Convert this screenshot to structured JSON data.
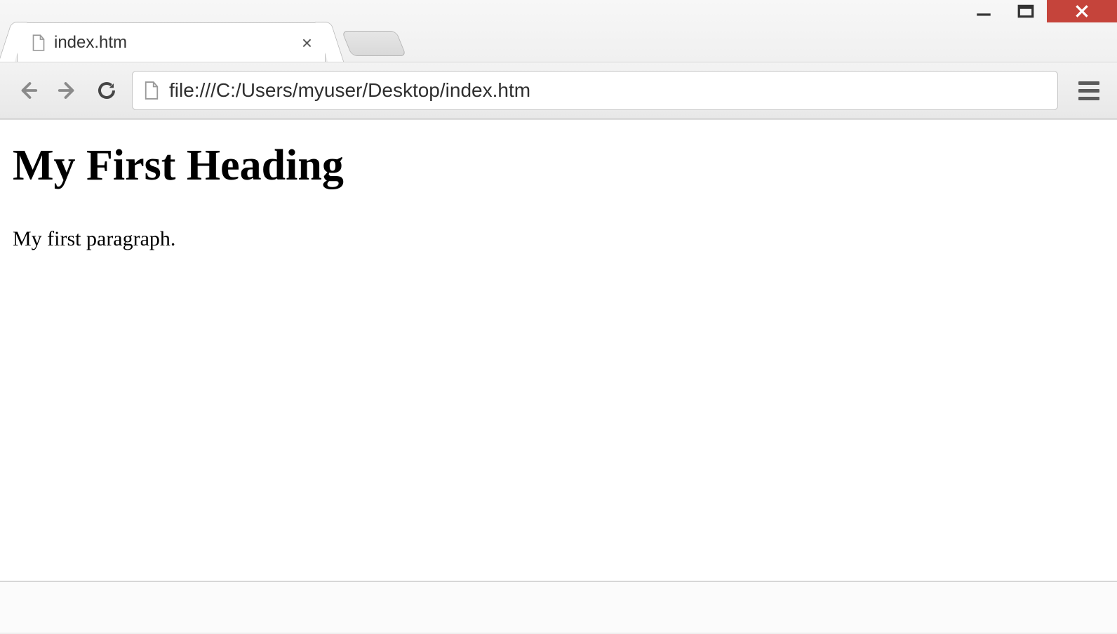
{
  "tab": {
    "title": "index.htm",
    "icon": "file-icon"
  },
  "toolbar": {
    "back_icon": "arrow-left-icon",
    "forward_icon": "arrow-right-icon",
    "reload_icon": "reload-icon",
    "menu_icon": "hamburger-icon"
  },
  "address_bar": {
    "icon": "file-icon",
    "url": "file:///C:/Users/myuser/Desktop/index.htm"
  },
  "page": {
    "heading": "My First Heading",
    "paragraph": "My first paragraph."
  },
  "window": {
    "minimize_icon": "minimize-icon",
    "maximize_icon": "maximize-icon",
    "close_icon": "close-icon"
  }
}
